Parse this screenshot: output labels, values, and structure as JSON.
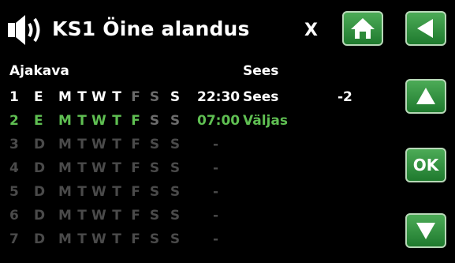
{
  "title": "KS1 Öine alandus",
  "close_label": "X",
  "ok_label": "OK",
  "header": {
    "left": "Ajakava",
    "right": "Sees"
  },
  "colors": {
    "white": "#ffffff",
    "green": "#5fbf52",
    "dim": "#4a4a4a",
    "active_day_dim": "#6b6b6b"
  },
  "icons": [
    "speaker-icon",
    "home-icon",
    "back-arrow-icon",
    "up-arrow-icon",
    "down-arrow-icon"
  ],
  "rows": [
    {
      "num": "1",
      "type": "E",
      "days": [
        "M",
        "T",
        "W",
        "T",
        "F",
        "S",
        "S"
      ],
      "days_active": [
        true,
        true,
        true,
        true,
        false,
        false,
        true
      ],
      "time": "22:30",
      "state": "Sees",
      "value": "-2",
      "style": "white"
    },
    {
      "num": "2",
      "type": "E",
      "days": [
        "M",
        "T",
        "W",
        "T",
        "F",
        "S",
        "S"
      ],
      "days_active": [
        true,
        true,
        true,
        true,
        true,
        false,
        false
      ],
      "time": "07:00",
      "state": "Väljas",
      "value": "",
      "style": "green"
    },
    {
      "num": "3",
      "type": "D",
      "days": [
        "M",
        "T",
        "W",
        "T",
        "F",
        "S",
        "S"
      ],
      "days_active": [
        false,
        false,
        false,
        false,
        false,
        false,
        false
      ],
      "time": "-",
      "state": "",
      "value": "",
      "style": "dim"
    },
    {
      "num": "4",
      "type": "D",
      "days": [
        "M",
        "T",
        "W",
        "T",
        "F",
        "S",
        "S"
      ],
      "days_active": [
        false,
        false,
        false,
        false,
        false,
        false,
        false
      ],
      "time": "-",
      "state": "",
      "value": "",
      "style": "dim"
    },
    {
      "num": "5",
      "type": "D",
      "days": [
        "M",
        "T",
        "W",
        "T",
        "F",
        "S",
        "S"
      ],
      "days_active": [
        false,
        false,
        false,
        false,
        false,
        false,
        false
      ],
      "time": "-",
      "state": "",
      "value": "",
      "style": "dim"
    },
    {
      "num": "6",
      "type": "D",
      "days": [
        "M",
        "T",
        "W",
        "T",
        "F",
        "S",
        "S"
      ],
      "days_active": [
        false,
        false,
        false,
        false,
        false,
        false,
        false
      ],
      "time": "-",
      "state": "",
      "value": "",
      "style": "dim"
    },
    {
      "num": "7",
      "type": "D",
      "days": [
        "M",
        "T",
        "W",
        "T",
        "F",
        "S",
        "S"
      ],
      "days_active": [
        false,
        false,
        false,
        false,
        false,
        false,
        false
      ],
      "time": "-",
      "state": "",
      "value": "",
      "style": "dim"
    }
  ]
}
